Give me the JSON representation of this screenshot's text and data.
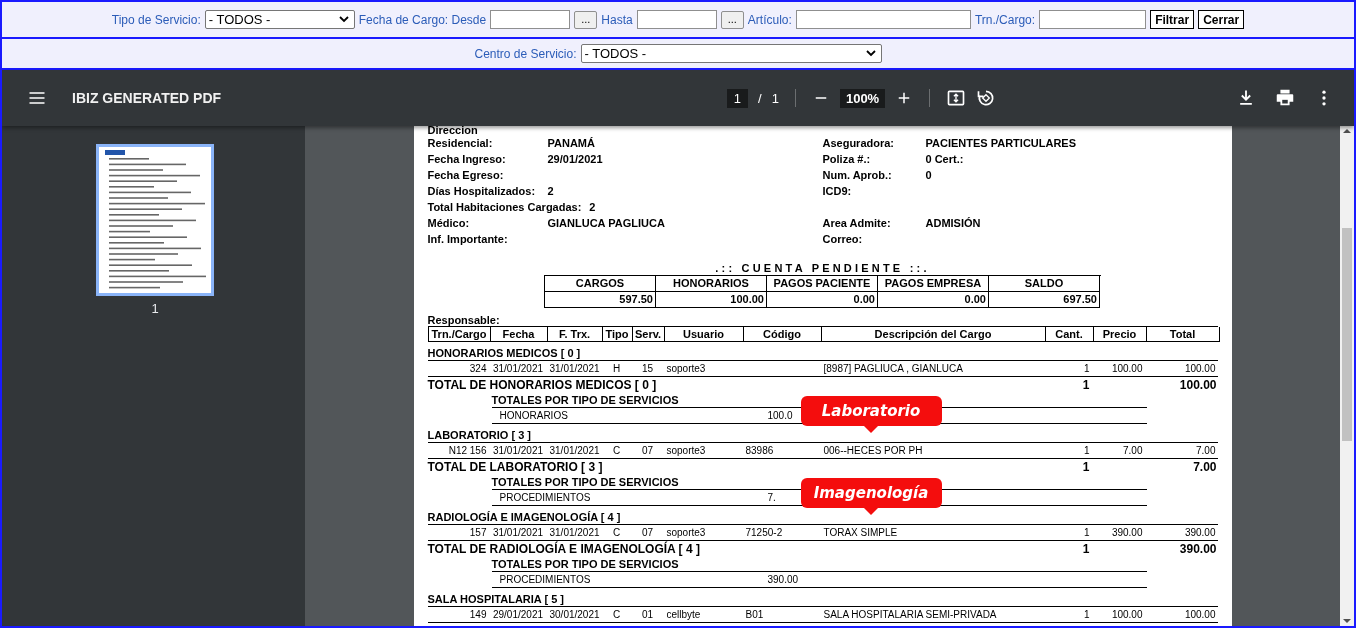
{
  "filter_rows": [
    [
      {
        "kind": "label",
        "text": "Tipo de Servicio:"
      },
      {
        "kind": "select",
        "value": "- TODOS -"
      },
      {
        "kind": "label",
        "text": "Fecha de Cargo: Desde"
      },
      {
        "kind": "date"
      },
      {
        "kind": "ellipsis_button",
        "text": "..."
      },
      {
        "kind": "label",
        "text": "Hasta"
      },
      {
        "kind": "date"
      },
      {
        "kind": "ellipsis_button",
        "text": "..."
      },
      {
        "kind": "label",
        "text": "Artículo:"
      },
      {
        "kind": "text"
      },
      {
        "kind": "label",
        "text": "Trn./Cargo:"
      },
      {
        "kind": "short_text"
      },
      {
        "kind": "button",
        "text": "Filtrar"
      },
      {
        "kind": "button",
        "text": "Cerrar"
      }
    ],
    [
      {
        "kind": "label",
        "text": "Centro de Servicio:"
      },
      {
        "kind": "wide_select",
        "value": "- TODOS -"
      }
    ]
  ],
  "pdf_viewer": {
    "title": "IBIZ GENERATED PDF",
    "page": "1",
    "separator": "/",
    "page_total": "1",
    "zoom": "100%",
    "thumbnails": [
      {
        "label": "1",
        "selected": true
      }
    ]
  },
  "document": {
    "info_rows": [
      {
        "left": {
          "label": "Direccion"
        }
      },
      {
        "left": {
          "label": "Residencial:",
          "value": "PANAMÁ"
        },
        "right": {
          "label": "Aseguradora:",
          "value": "PACIENTES PARTICULARES"
        }
      },
      {
        "left": {
          "label": "Fecha Ingreso:",
          "value": "29/01/2021"
        },
        "right": {
          "label": "Poliza #.:",
          "value": "0 Cert.:"
        }
      },
      {
        "left": {
          "label": "Fecha Egreso:"
        },
        "right": {
          "label": "Num. Aprob.:",
          "value": "0"
        }
      },
      {
        "left": {
          "label": "Días Hospitalizados:",
          "value": "2"
        },
        "right": {
          "label": "ICD9:"
        }
      },
      {
        "left": {
          "label": "Total Habitaciones Cargadas:",
          "value": "2"
        }
      },
      {
        "left": {
          "label": "Médico:",
          "value": "GIANLUCA  PAGLIUCA"
        },
        "right": {
          "label": "Area Admite:",
          "value": "ADMISIÓN"
        }
      },
      {
        "left": {
          "label": "Inf. Importante:"
        },
        "right": {
          "label": "Correo:"
        }
      }
    ],
    "summary": {
      "title": ".:: CUENTA PENDIENTE ::.",
      "columns": [
        "CARGOS",
        "HONORARIOS",
        "PAGOS PACIENTE",
        "PAGOS EMPRESA",
        "SALDO"
      ],
      "values": [
        "597.50",
        "100.00",
        "0.00",
        "0.00",
        "697.50"
      ]
    },
    "responsable_label": "Responsable:",
    "columns": [
      "Trn./Cargo",
      "Fecha",
      "F. Trx.",
      "Tipo",
      "Serv.",
      "Usuario",
      "Código",
      "Descripción del Cargo",
      "Cant.",
      "Precio",
      "Total"
    ],
    "sections": [
      {
        "title": "HONORARIOS MEDICOS [ 0 ]",
        "rows": [
          [
            "324",
            "31/01/2021",
            "31/01/2021",
            "H",
            "15",
            "soporte3",
            null,
            "[8987] PAGLIUCA  , GIANLUCA",
            "1",
            "100.00",
            "100.00"
          ]
        ],
        "total": {
          "label": "TOTAL DE HONORARIOS MEDICOS [ 0 ]",
          "cant": "1",
          "amount": "100.00"
        },
        "subtotals": {
          "title": "TOTALES POR TIPO DE SERVICIOS",
          "rows": [
            {
              "label": "HONORARIOS",
              "amount": "100.0"
            }
          ]
        }
      },
      {
        "title": "LABORATORIO [ 3 ]",
        "callout": "Laboratorio",
        "rows": [
          [
            "N12  156",
            "31/01/2021",
            "31/01/2021",
            "C",
            "07",
            "soporte3",
            "83986",
            "006--HECES POR PH",
            "1",
            "7.00",
            "7.00"
          ]
        ],
        "total": {
          "label": "TOTAL DE LABORATORIO [ 3 ]",
          "cant": "1",
          "amount": "7.00"
        },
        "subtotals": {
          "title": "TOTALES POR TIPO DE SERVICIOS",
          "rows": [
            {
              "label": "PROCEDIMIENTOS",
              "amount": "7."
            }
          ]
        }
      },
      {
        "title": "RADIOLOGÍA E IMAGENOLOGÍA [ 4 ]",
        "callout": "Imagenología",
        "rows": [
          [
            "157",
            "31/01/2021",
            "31/01/2021",
            "C",
            "07",
            "soporte3",
            "71250-2",
            "TORAX SIMPLE",
            "1",
            "390.00",
            "390.00"
          ]
        ],
        "total": {
          "label": "TOTAL DE RADIOLOGÍA E IMAGENOLOGÍA [ 4 ]",
          "cant": "1",
          "amount": "390.00"
        },
        "subtotals": {
          "title": "TOTALES POR TIPO DE SERVICIOS",
          "rows": [
            {
              "label": "PROCEDIMIENTOS",
              "amount": "390.00"
            }
          ]
        }
      },
      {
        "title": "SALA HOSPITALARIA [ 5 ]",
        "rows": [
          [
            "149",
            "29/01/2021",
            "30/01/2021",
            "C",
            "01",
            "cellbyte",
            "B01",
            "SALA HOSPITALARIA SEMI-PRIVADA",
            "1",
            "100.00",
            "100.00"
          ]
        ]
      }
    ]
  }
}
